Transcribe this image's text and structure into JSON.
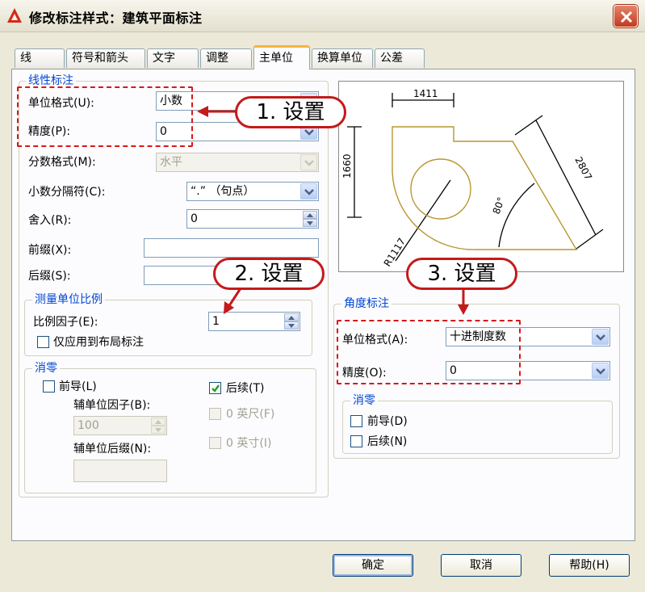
{
  "window": {
    "title": "修改标注样式：建筑平面标注",
    "app_icon": "autocad-a-icon",
    "close_icon": "close-x-icon"
  },
  "tabs": [
    {
      "label": "线",
      "active": false
    },
    {
      "label": "符号和箭头",
      "active": false
    },
    {
      "label": "文字",
      "active": false
    },
    {
      "label": "调整",
      "active": false
    },
    {
      "label": "主单位",
      "active": true
    },
    {
      "label": "换算单位",
      "active": false
    },
    {
      "label": "公差",
      "active": false
    }
  ],
  "linear": {
    "title": "线性标注",
    "unit_format": {
      "label": "单位格式(U):",
      "value": "小数"
    },
    "precision": {
      "label": "精度(P):",
      "value": "0"
    },
    "fraction_format": {
      "label": "分数格式(M):",
      "value": "水平"
    },
    "decimal_separator": {
      "label": "小数分隔符(C):",
      "value": "“.” （句点）"
    },
    "round_off": {
      "label": "舍入(R):",
      "value": "0"
    },
    "prefix": {
      "label": "前缀(X):",
      "value": ""
    },
    "suffix": {
      "label": "后缀(S):",
      "value": ""
    }
  },
  "scale": {
    "title": "测量单位比例",
    "factor": {
      "label": "比例因子(E):",
      "value": "1"
    },
    "layout_only": {
      "label": "仅应用到布局标注",
      "checked": false
    }
  },
  "zero_linear": {
    "title": "消零",
    "leading": {
      "label": "前导(L)",
      "checked": false
    },
    "trailing": {
      "label": "后续(T)",
      "checked": true
    },
    "sub_factor": {
      "label": "辅单位因子(B):",
      "value": "100"
    },
    "sub_suffix": {
      "label": "辅单位后缀(N):",
      "value": ""
    },
    "feet": {
      "label": "0 英尺(F)",
      "checked": false
    },
    "inches": {
      "label": "0 英寸(I)",
      "checked": false
    }
  },
  "preview": {
    "dim_top": "1411",
    "dim_left": "1660",
    "dim_slant": "2807",
    "dim_angle": "80°",
    "dim_radius": "R1117"
  },
  "angular": {
    "title": "角度标注",
    "unit_format": {
      "label": "单位格式(A):",
      "value": "十进制度数"
    },
    "precision": {
      "label": "精度(O):",
      "value": "0"
    }
  },
  "zero_angular": {
    "title": "消零",
    "leading": {
      "label": "前导(D)",
      "checked": false
    },
    "trailing": {
      "label": "后续(N)",
      "checked": false
    }
  },
  "buttons": {
    "ok": "确定",
    "cancel": "取消",
    "help": "帮助(H)"
  },
  "annotations": [
    {
      "text": "1. 设置"
    },
    {
      "text": "2. 设置"
    },
    {
      "text": "3. 设置"
    }
  ],
  "colors": {
    "annotation_red": "#d81818",
    "group_title_blue": "#0046d5",
    "preview_shape": "#b8962e"
  }
}
